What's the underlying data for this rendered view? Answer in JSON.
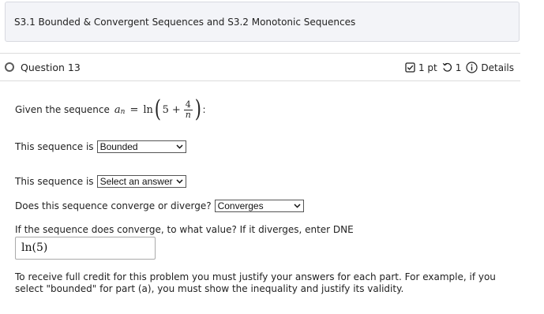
{
  "assignment": {
    "title": "S3.1 Bounded & Convergent Sequences and S3.2 Monotonic Sequences"
  },
  "question": {
    "title": "Question 13",
    "points": "1 pt",
    "attempts": "1",
    "details_label": "Details"
  },
  "problem": {
    "given_prefix": "Given the sequence",
    "given_suffix": ":",
    "math": {
      "var": "a",
      "sub": "n",
      "eq": "=",
      "fn": "ln",
      "five": "5",
      "plus": "+",
      "num": "4",
      "den": "n"
    },
    "q1_label": "This sequence is",
    "q1_value": "Bounded",
    "q2_label": "This sequence is",
    "q2_value": "Select an answer",
    "q3_label": "Does this sequence converge or diverge?",
    "q3_value": "Converges",
    "q4_label": "If the sequence does converge, to what value? If it diverges, enter DNE",
    "q4_value": "ln(5)"
  },
  "note": "To receive full credit for this problem you must justify your answers for each part.  For example, if you select \"bounded\" for part (a), you must show the inequality and justify its validity.",
  "icons": [
    "checkbox-icon",
    "retry-icon",
    "info-icon",
    "chevron-down-icon"
  ]
}
